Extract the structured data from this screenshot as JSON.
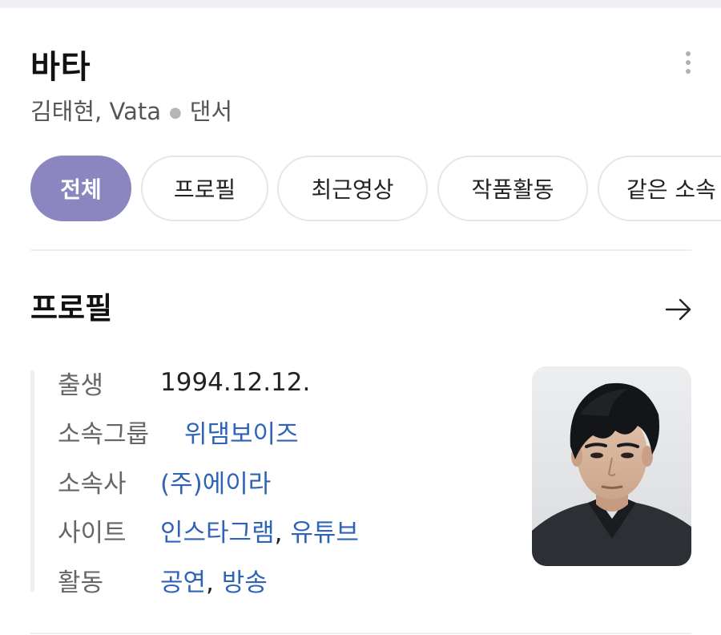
{
  "header": {
    "title": "바타",
    "subtitle_names": "김태현, Vata",
    "subtitle_job": "댄서"
  },
  "tabs": [
    {
      "label": "전체",
      "active": true
    },
    {
      "label": "프로필",
      "active": false
    },
    {
      "label": "최근영상",
      "active": false
    },
    {
      "label": "작품활동",
      "active": false
    },
    {
      "label": "같은 소속",
      "active": false
    }
  ],
  "profile": {
    "section_title": "프로필",
    "rows": {
      "birth": {
        "label": "출생",
        "value": "1994.12.12."
      },
      "group": {
        "label": "소속그룹",
        "value": "위댐보이즈"
      },
      "agency": {
        "label": "소속사",
        "value": "(주)에이라"
      },
      "site": {
        "label": "사이트",
        "values": [
          "인스타그램",
          "유튜브"
        ]
      },
      "activity": {
        "label": "활동",
        "values": [
          "공연",
          "방송"
        ]
      }
    },
    "photo_alt": "profile-photo"
  },
  "colors": {
    "accent": "#8b86c0",
    "link": "#2f63b8",
    "label": "#666666",
    "divider": "#eeeef0"
  }
}
